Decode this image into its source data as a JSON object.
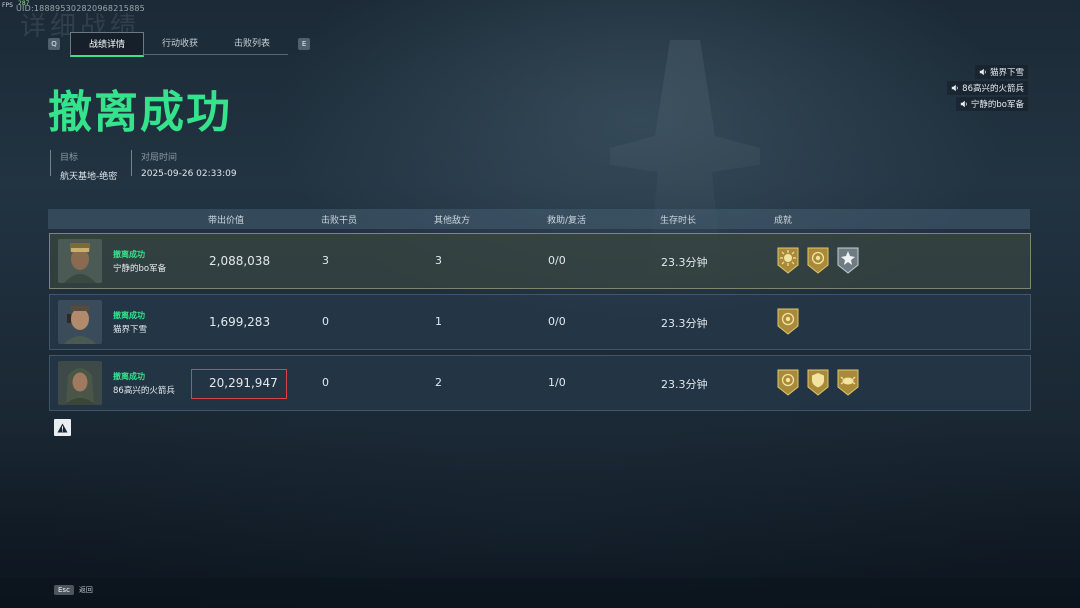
{
  "overlay": {
    "fps_label": "FPS",
    "fps_value": "287",
    "uid": "UID:188895302820968215885",
    "ghost_title": "详细战绩"
  },
  "tabs": {
    "left_key": "Q",
    "right_key": "E",
    "items": [
      {
        "label": "战绩详情",
        "active": true
      },
      {
        "label": "行动收获",
        "active": false
      },
      {
        "label": "击败列表",
        "active": false
      }
    ]
  },
  "result_title": "撤离成功",
  "meta": {
    "target_label": "目标",
    "target_value": "航天基地-绝密",
    "time_label": "对局时间",
    "time_value": "2025-09-26 02:33:09"
  },
  "voice": [
    "猫界下雪",
    "86高兴的火箭兵",
    "宁静的bo军备"
  ],
  "table": {
    "headers": [
      "带出价值",
      "击败干员",
      "其他敌方",
      "救助/复活",
      "生存时长",
      "成就"
    ],
    "rows": [
      {
        "status": "撤离成功",
        "name": "宁静的bo军备",
        "value": "2,088,038",
        "kills": "3",
        "others": "3",
        "assist": "0/0",
        "survival": "23.3分钟",
        "medals": [
          "gold-sun-medal",
          "gold-circle-medal",
          "silver-star-medal"
        ],
        "highlighted": true
      },
      {
        "status": "撤离成功",
        "name": "猫界下雪",
        "value": "1,699,283",
        "kills": "0",
        "others": "1",
        "assist": "0/0",
        "survival": "23.3分钟",
        "medals": [
          "gold-circle-medal"
        ],
        "highlighted": false
      },
      {
        "status": "撤离成功",
        "name": "86高兴的火箭兵",
        "value": "20,291,947",
        "kills": "0",
        "others": "2",
        "assist": "1/0",
        "survival": "23.3分钟",
        "medals": [
          "gold-circle-medal",
          "gold-shield-medal",
          "gold-crab-medal"
        ],
        "highlighted": false
      }
    ]
  },
  "footer": {
    "esc_key": "Esc",
    "esc_label": "返回"
  }
}
